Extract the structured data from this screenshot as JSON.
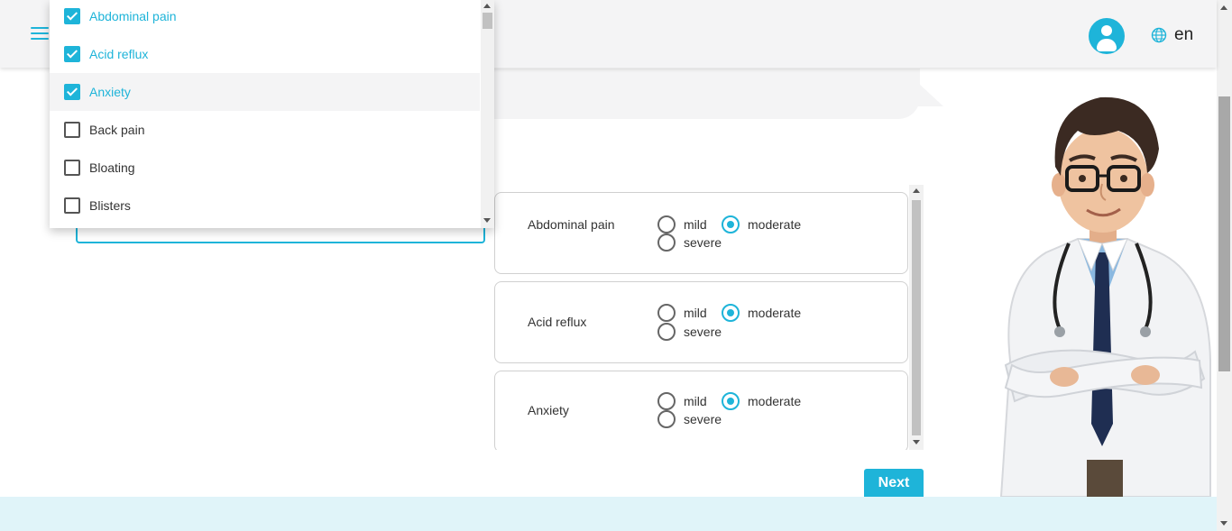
{
  "header": {
    "menu_icon": "hamburger-menu-icon",
    "avatar_icon": "user-avatar-icon",
    "language_icon": "globe-icon",
    "language": "en"
  },
  "symptom_dropdown": {
    "options": [
      {
        "label": "Abdominal pain",
        "checked": true
      },
      {
        "label": "Acid reflux",
        "checked": true
      },
      {
        "label": "Anxiety",
        "checked": true
      },
      {
        "label": "Back pain",
        "checked": false
      },
      {
        "label": "Bloating",
        "checked": false
      },
      {
        "label": "Blisters",
        "checked": false
      }
    ]
  },
  "severity_cards": [
    {
      "symptom": "Abdominal pain",
      "mild": "mild",
      "moderate": "moderate",
      "severe": "severe",
      "selected": "moderate"
    },
    {
      "symptom": "Acid reflux",
      "mild": "mild",
      "moderate": "moderate",
      "severe": "severe",
      "selected": "moderate"
    },
    {
      "symptom": "Anxiety",
      "mild": "mild",
      "moderate": "moderate",
      "severe": "severe",
      "selected": "moderate"
    }
  ],
  "actions": {
    "next_label": "Next"
  },
  "colors": {
    "accent": "#1eb4d9",
    "header_bg": "#f4f4f5",
    "footer_bg": "#e0f4f9"
  },
  "illustration": "doctor-illustration"
}
